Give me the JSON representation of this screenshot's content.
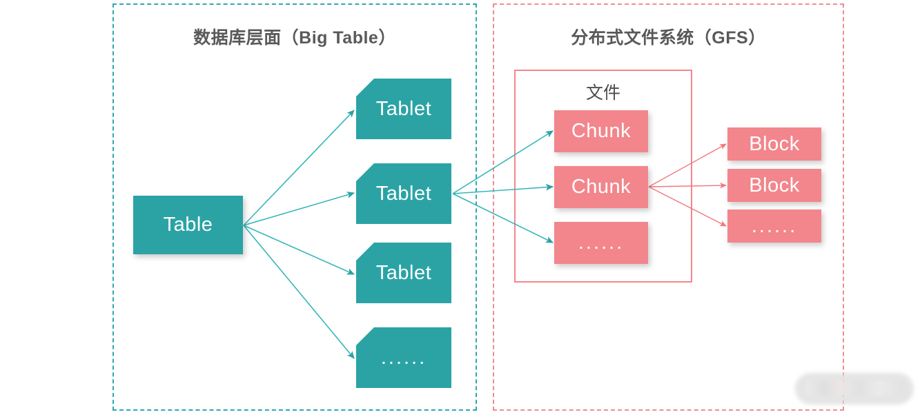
{
  "diagram": {
    "title_left": "数据库层面（Big Table）",
    "title_right": "分布式文件系统（GFS）",
    "file_label": "文件",
    "colors": {
      "teal": "#2BA3A5",
      "teal_dashed": "#2CA9AF",
      "pink": "#F2868C",
      "pink_dashed": "#F18B90",
      "title_text": "#595959",
      "label_text": "#4D4D4D",
      "node_text": "#FFFFFF",
      "background": "#FFFFFF"
    },
    "panels": [
      {
        "id": "left",
        "label": "数据库层面（Big Table）",
        "border_style": "dashed",
        "border_color": "#2CA9AF"
      },
      {
        "id": "right",
        "label": "分布式文件系统（GFS）",
        "border_style": "dashed",
        "border_color": "#F18B90"
      }
    ],
    "nodes": {
      "table": {
        "label": "Table",
        "color": "#2BA3A5",
        "shape": "rect"
      },
      "tablets": [
        {
          "label": "Tablet",
          "color": "#2BA3A5",
          "shape": "chamfer"
        },
        {
          "label": "Tablet",
          "color": "#2BA3A5",
          "shape": "chamfer"
        },
        {
          "label": "Tablet",
          "color": "#2BA3A5",
          "shape": "chamfer"
        },
        {
          "label": "......",
          "color": "#2BA3A5",
          "shape": "chamfer"
        }
      ],
      "chunks": [
        {
          "label": "Chunk",
          "color": "#F2868C",
          "shape": "rect"
        },
        {
          "label": "Chunk",
          "color": "#F2868C",
          "shape": "rect"
        },
        {
          "label": "......",
          "color": "#F2868C",
          "shape": "rect"
        }
      ],
      "blocks": [
        {
          "label": "Block",
          "color": "#F2868C",
          "shape": "rect"
        },
        {
          "label": "Block",
          "color": "#F2868C",
          "shape": "rect"
        },
        {
          "label": "......",
          "color": "#F2868C",
          "shape": "rect"
        }
      ]
    },
    "edges": [
      {
        "from": "table",
        "to": "tablet-1",
        "color": "#2BA3A5"
      },
      {
        "from": "table",
        "to": "tablet-2",
        "color": "#2BA3A5"
      },
      {
        "from": "table",
        "to": "tablet-3",
        "color": "#2BA3A5"
      },
      {
        "from": "table",
        "to": "tablet-4",
        "color": "#2BA3A5"
      },
      {
        "from": "tablet-2",
        "to": "chunk-1",
        "color": "#2BA3A5"
      },
      {
        "from": "tablet-2",
        "to": "chunk-2",
        "color": "#2BA3A5"
      },
      {
        "from": "tablet-2",
        "to": "chunk-3",
        "color": "#2BA3A5"
      },
      {
        "from": "chunk-2",
        "to": "block-1",
        "color": "#F2868C"
      },
      {
        "from": "chunk-2",
        "to": "block-2",
        "color": "#F2868C"
      },
      {
        "from": "chunk-2",
        "to": "block-3",
        "color": "#F2868C"
      }
    ]
  }
}
